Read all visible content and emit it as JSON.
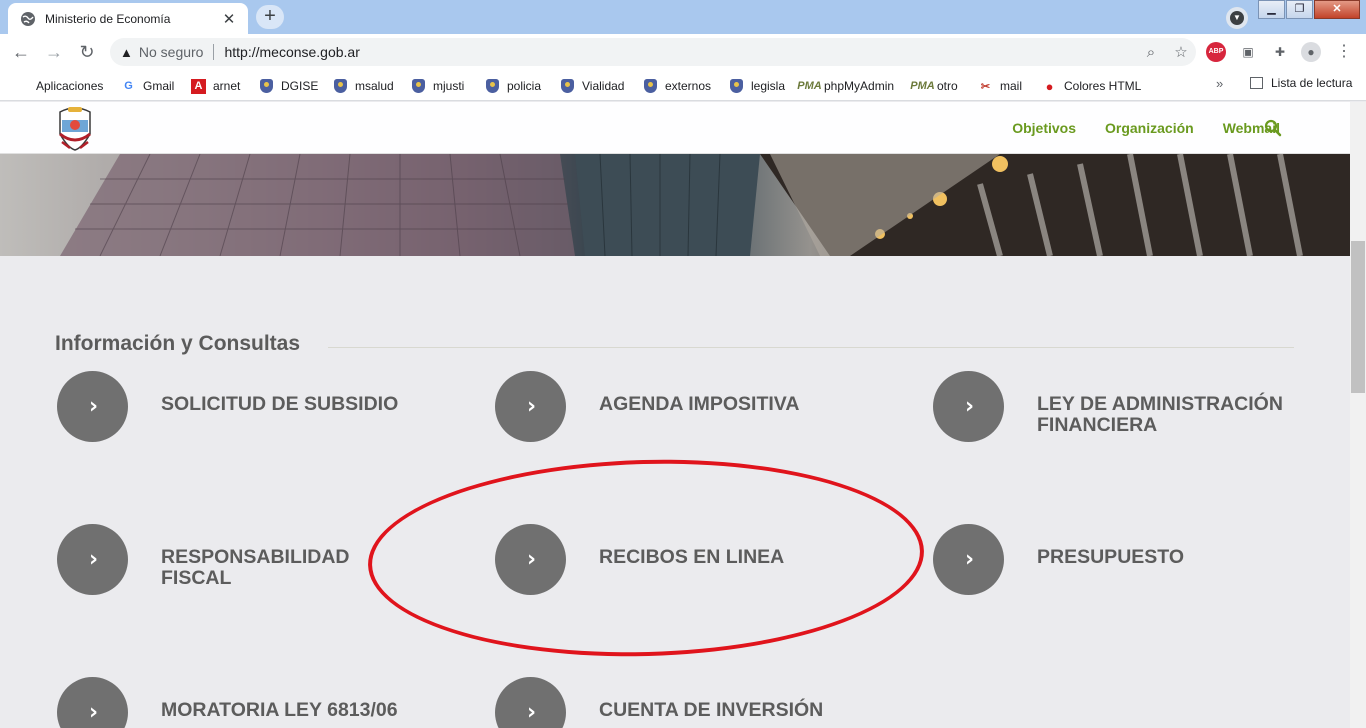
{
  "browser": {
    "tab_title": "Ministerio de Economía",
    "tab_close": "✕",
    "new_tab": "+",
    "window_buttons": [
      "▁",
      "❐",
      "✕"
    ],
    "security_label": "No seguro",
    "url": "http://meconse.gob.ar",
    "nav": {
      "back": "←",
      "forward": "→",
      "reload": "↻"
    },
    "more_bookmarks": "»",
    "reading_list": "Lista de lectura"
  },
  "bookmarks": [
    {
      "label": "Aplicaciones",
      "icon": "apps-grid-icon"
    },
    {
      "label": "Gmail",
      "icon": "google-icon"
    },
    {
      "label": "arnet",
      "icon": "arnet-icon"
    },
    {
      "label": "DGISE",
      "icon": "shield-icon"
    },
    {
      "label": "msalud",
      "icon": "shield-icon"
    },
    {
      "label": "mjusti",
      "icon": "shield-icon"
    },
    {
      "label": "policia",
      "icon": "shield-icon"
    },
    {
      "label": "Vialidad",
      "icon": "shield-icon"
    },
    {
      "label": "externos",
      "icon": "shield-icon"
    },
    {
      "label": "legisla",
      "icon": "shield-icon"
    },
    {
      "label": "phpMyAdmin",
      "icon": "pma-icon"
    },
    {
      "label": "otro",
      "icon": "pma-icon"
    },
    {
      "label": "mail",
      "icon": "tools-icon"
    },
    {
      "label": "Colores HTML",
      "icon": "opera-icon"
    }
  ],
  "site": {
    "nav": [
      "Objetivos",
      "Organización",
      "Webmail"
    ],
    "section_title": "Información y Consultas",
    "items": [
      {
        "label": "SOLICITUD DE SUBSIDIO"
      },
      {
        "label": "AGENDA IMPOSITIVA"
      },
      {
        "label": "LEY DE ADMINISTRACIÓN FINANCIERA"
      },
      {
        "label": "RESPONSABILIDAD FISCAL"
      },
      {
        "label": "RECIBOS EN LINEA"
      },
      {
        "label": "PRESUPUESTO"
      },
      {
        "label": "MORATORIA LEY 6813/06"
      },
      {
        "label": "CUENTA DE INVERSIÓN"
      }
    ],
    "item_arrow": "›"
  },
  "colors": {
    "accent_green": "#6a9a1f",
    "circle_gray": "#707070",
    "annotation_red": "#e0141c"
  }
}
